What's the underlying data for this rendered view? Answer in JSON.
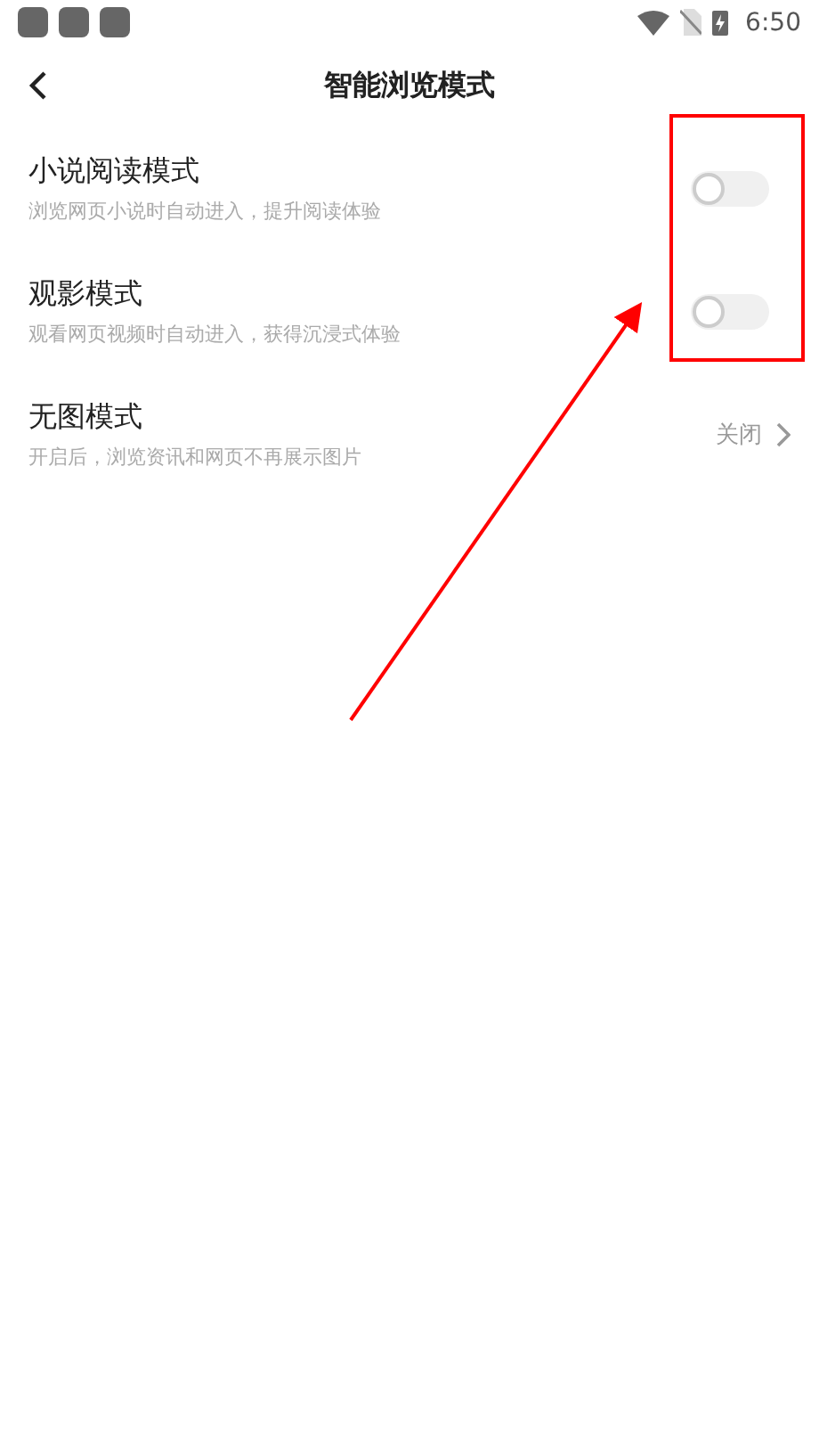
{
  "status_bar": {
    "time": "6:50"
  },
  "header": {
    "title": "智能浏览模式"
  },
  "settings": [
    {
      "kind": "switch",
      "title": "小说阅读模式",
      "subtitle": "浏览网页小说时自动进入，提升阅读体验",
      "on": false
    },
    {
      "kind": "switch",
      "title": "观影模式",
      "subtitle": "观看网页视频时自动进入，获得沉浸式体验",
      "on": false
    },
    {
      "kind": "value",
      "title": "无图模式",
      "subtitle": "开启后，浏览资讯和网页不再展示图片",
      "value": "关闭"
    }
  ]
}
